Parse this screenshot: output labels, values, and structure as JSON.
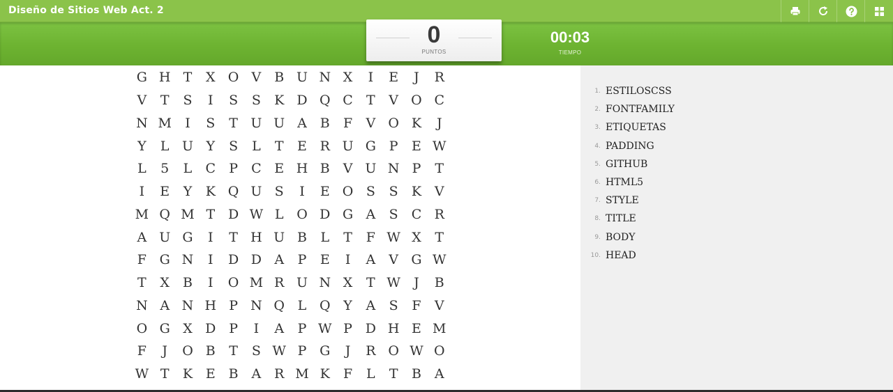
{
  "app": {
    "title": "Diseño de Sitios Web Act. 2"
  },
  "toolbar": {
    "buttons": [
      {
        "name": "print",
        "icon": "printer-icon"
      },
      {
        "name": "restart",
        "icon": "refresh-icon"
      },
      {
        "name": "help",
        "icon": "help-icon"
      },
      {
        "name": "apps",
        "icon": "grid-icon"
      }
    ]
  },
  "score": {
    "value": "0",
    "label": "PUNTOS"
  },
  "timer": {
    "value": "00:03",
    "label": "TIEMPO"
  },
  "grid": {
    "rows": [
      [
        "G",
        "H",
        "T",
        "X",
        "O",
        "V",
        "B",
        "U",
        "N",
        "X",
        "I",
        "E",
        "J",
        "R"
      ],
      [
        "V",
        "T",
        "S",
        "I",
        "S",
        "S",
        "K",
        "D",
        "Q",
        "C",
        "T",
        "V",
        "O",
        "C"
      ],
      [
        "N",
        "M",
        "I",
        "S",
        "T",
        "U",
        "U",
        "A",
        "B",
        "F",
        "V",
        "O",
        "K",
        "J"
      ],
      [
        "Y",
        "L",
        "U",
        "Y",
        "S",
        "L",
        "T",
        "E",
        "R",
        "U",
        "G",
        "P",
        "E",
        "W"
      ],
      [
        "L",
        "5",
        "L",
        "C",
        "P",
        "C",
        "E",
        "H",
        "B",
        "V",
        "U",
        "N",
        "P",
        "T"
      ],
      [
        "I",
        "E",
        "Y",
        "K",
        "Q",
        "U",
        "S",
        "I",
        "E",
        "O",
        "S",
        "S",
        "K",
        "V"
      ],
      [
        "M",
        "Q",
        "M",
        "T",
        "D",
        "W",
        "L",
        "O",
        "D",
        "G",
        "A",
        "S",
        "C",
        "R"
      ],
      [
        "A",
        "U",
        "G",
        "I",
        "T",
        "H",
        "U",
        "B",
        "L",
        "T",
        "F",
        "W",
        "X",
        "T"
      ],
      [
        "F",
        "G",
        "N",
        "I",
        "D",
        "D",
        "A",
        "P",
        "E",
        "I",
        "A",
        "V",
        "G",
        "W"
      ],
      [
        "T",
        "X",
        "B",
        "I",
        "O",
        "M",
        "R",
        "U",
        "N",
        "X",
        "T",
        "W",
        "J",
        "B"
      ],
      [
        "N",
        "A",
        "N",
        "H",
        "P",
        "N",
        "Q",
        "L",
        "Q",
        "Y",
        "A",
        "S",
        "F",
        "V"
      ],
      [
        "O",
        "G",
        "X",
        "D",
        "P",
        "I",
        "A",
        "P",
        "W",
        "P",
        "D",
        "H",
        "E",
        "M"
      ],
      [
        "F",
        "J",
        "O",
        "B",
        "T",
        "S",
        "W",
        "P",
        "G",
        "J",
        "R",
        "O",
        "W",
        "O"
      ],
      [
        "W",
        "T",
        "K",
        "E",
        "B",
        "A",
        "R",
        "M",
        "K",
        "F",
        "L",
        "T",
        "B",
        "A"
      ]
    ]
  },
  "words": [
    {
      "num": "1.",
      "text": "ESTILOSCSS"
    },
    {
      "num": "2.",
      "text": "FONTFAMILY"
    },
    {
      "num": "3.",
      "text": "ETIQUETAS"
    },
    {
      "num": "4.",
      "text": "PADDING"
    },
    {
      "num": "5.",
      "text": "GITHUB"
    },
    {
      "num": "6.",
      "text": "HTML5"
    },
    {
      "num": "7.",
      "text": "STYLE"
    },
    {
      "num": "8.",
      "text": "TITLE"
    },
    {
      "num": "9.",
      "text": "BODY"
    },
    {
      "num": "10.",
      "text": "HEAD"
    }
  ],
  "colors": {
    "bar": "#8bc34a",
    "band": "#6db331",
    "panel": "#f0f0f0"
  }
}
